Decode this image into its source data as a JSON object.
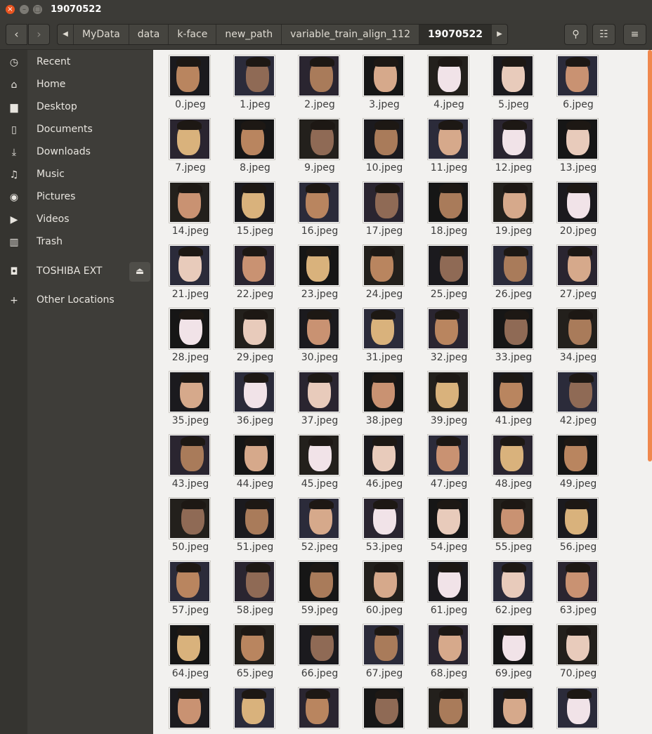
{
  "window": {
    "title": "19070522",
    "close_glyph": "×",
    "min_glyph": "–",
    "max_glyph": "□"
  },
  "header": {
    "back_glyph": "‹",
    "forward_glyph": "›",
    "breadcrumb": [
      "MyData",
      "data",
      "k-face",
      "new_path",
      "variable_train_align_112",
      "19070522"
    ],
    "search_glyph": "⚲",
    "view_glyph": "☷",
    "menu_glyph": "≡"
  },
  "sidebar": {
    "items": [
      {
        "label": "Recent",
        "icon": "clock-icon",
        "glyph": "◷"
      },
      {
        "label": "Home",
        "icon": "home-icon",
        "glyph": "⌂"
      },
      {
        "label": "Desktop",
        "icon": "folder-icon",
        "glyph": "▆"
      },
      {
        "label": "Documents",
        "icon": "document-icon",
        "glyph": "▯"
      },
      {
        "label": "Downloads",
        "icon": "download-icon",
        "glyph": "⤓"
      },
      {
        "label": "Music",
        "icon": "music-icon",
        "glyph": "♫"
      },
      {
        "label": "Pictures",
        "icon": "camera-icon",
        "glyph": "◉"
      },
      {
        "label": "Videos",
        "icon": "video-icon",
        "glyph": "▶"
      },
      {
        "label": "Trash",
        "icon": "trash-icon",
        "glyph": "▥"
      },
      {
        "label": "TOSHIBA EXT",
        "icon": "drive-icon",
        "glyph": "◘"
      },
      {
        "label": "Other Locations",
        "icon": "plus-icon",
        "glyph": "+"
      }
    ],
    "eject_glyph": "⏏"
  },
  "files": [
    "0.jpeg",
    "1.jpeg",
    "2.jpeg",
    "3.jpeg",
    "4.jpeg",
    "5.jpeg",
    "6.jpeg",
    "7.jpeg",
    "8.jpeg",
    "9.jpeg",
    "10.jpeg",
    "11.jpeg",
    "12.jpeg",
    "13.jpeg",
    "14.jpeg",
    "15.jpeg",
    "16.jpeg",
    "17.jpeg",
    "18.jpeg",
    "19.jpeg",
    "20.jpeg",
    "21.jpeg",
    "22.jpeg",
    "23.jpeg",
    "24.jpeg",
    "25.jpeg",
    "26.jpeg",
    "27.jpeg",
    "28.jpeg",
    "29.jpeg",
    "30.jpeg",
    "31.jpeg",
    "32.jpeg",
    "33.jpeg",
    "34.jpeg",
    "35.jpeg",
    "36.jpeg",
    "37.jpeg",
    "38.jpeg",
    "39.jpeg",
    "41.jpeg",
    "42.jpeg",
    "43.jpeg",
    "44.jpeg",
    "45.jpeg",
    "46.jpeg",
    "47.jpeg",
    "48.jpeg",
    "49.jpeg",
    "50.jpeg",
    "51.jpeg",
    "52.jpeg",
    "53.jpeg",
    "54.jpeg",
    "55.jpeg",
    "56.jpeg",
    "57.jpeg",
    "58.jpeg",
    "59.jpeg",
    "60.jpeg",
    "61.jpeg",
    "62.jpeg",
    "63.jpeg",
    "64.jpeg",
    "65.jpeg",
    "66.jpeg",
    "67.jpeg",
    "68.jpeg",
    "69.jpeg",
    "70.jpeg",
    "",
    "",
    "",
    "",
    "",
    "",
    ""
  ],
  "colors": {
    "accent": "#e95420",
    "scrollbar": "#f0884d",
    "thumb_backgrounds": [
      "#1b1a1e",
      "#2a2530",
      "#23201c",
      "#2b2b3a",
      "#161616"
    ],
    "face_tones": [
      "#c99272",
      "#d6a98b",
      "#b9855f",
      "#e8cbbb",
      "#a97b5a",
      "#d9b27c",
      "#f1e3e8",
      "#8f6a55"
    ]
  }
}
